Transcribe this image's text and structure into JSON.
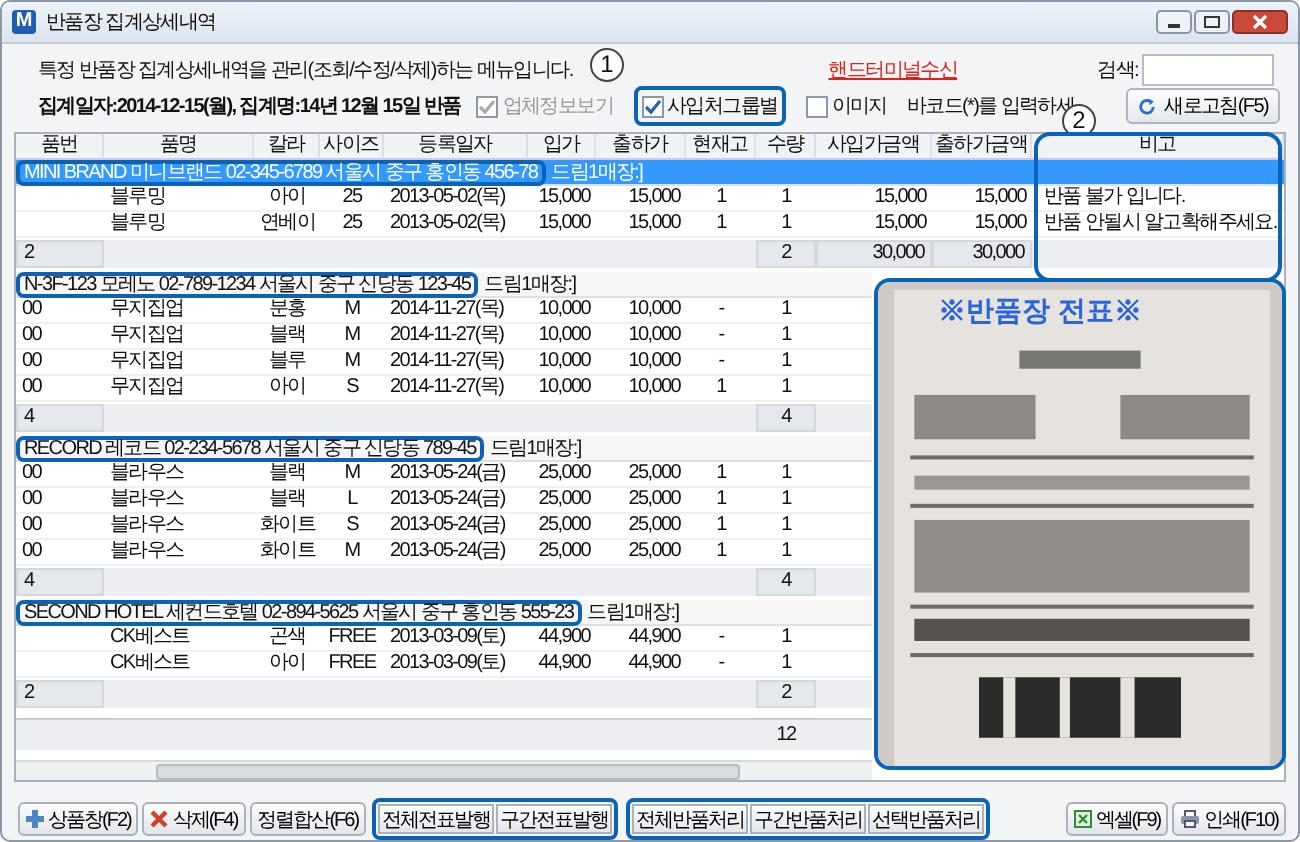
{
  "window": {
    "app_icon": "M",
    "title": "반품장 집계상세내역"
  },
  "header": {
    "description": "특정 반품장 집계상세내역을 관리(조회/수정/삭제)하는 메뉴입니다.",
    "link": "핸드터미널수신",
    "search_label": "검색:",
    "summary": "집계일자:2014-12-15(월), 집계명:14년 12월 15일 반품",
    "options": [
      {
        "label": "업체정보보기",
        "checked": true,
        "disabled": true,
        "highlighted": false
      },
      {
        "label": "사입처그룹별",
        "checked": true,
        "disabled": false,
        "highlighted": true
      },
      {
        "label": "이미지",
        "checked": false,
        "disabled": false,
        "highlighted": false
      }
    ],
    "barcode_hint": "바코드(*)를 입력하세",
    "refresh_button": "새로고침(F5)"
  },
  "markers": [
    "1",
    "2"
  ],
  "table": {
    "columns": [
      "품번",
      "품명",
      "칼라",
      "사이즈",
      "등록일자",
      "입가",
      "출하가",
      "현재고",
      "수량",
      "사입가금액",
      "출하가금액",
      "비고"
    ],
    "groups": [
      {
        "vendor": "MINI BRAND 미니브랜드 02-345-6789  서울시 중구 홍인동 456-78",
        "store": "드림1매장:]",
        "selected": true,
        "highlighted": true,
        "rows": [
          {
            "name": "블루밍",
            "shade": "아이",
            "size": "25",
            "date": "2013-05-02(목)",
            "cost": "15,000",
            "price": "15,000",
            "stock": "1",
            "qty": "1",
            "cost_amount": "15,000",
            "price_amount": "15,000",
            "note": "반품 불가 입니다."
          },
          {
            "name": "블루밍",
            "shade": "연베이",
            "size": "25",
            "date": "2013-05-02(목)",
            "cost": "15,000",
            "price": "15,000",
            "stock": "1",
            "qty": "1",
            "cost_amount": "15,000",
            "price_amount": "15,000",
            "note": "반품 안될시 알고확해주세요."
          }
        ],
        "subtotal": {
          "code": "2",
          "qty": "2",
          "cost_amount": "30,000",
          "price_amount": "30,000"
        }
      },
      {
        "vendor": "N-3F-123 모레노 02-789-1234  서울시 중구 신당동 123-45",
        "store": "드림1매장:]",
        "selected": false,
        "highlighted": true,
        "rows": [
          {
            "code": "00",
            "name": "무지집업",
            "shade": "분홍",
            "size": "M",
            "date": "2014-11-27(목)",
            "cost": "10,000",
            "price": "10,000",
            "stock": "-",
            "qty": "1"
          },
          {
            "code": "00",
            "name": "무지집업",
            "shade": "블랙",
            "size": "M",
            "date": "2014-11-27(목)",
            "cost": "10,000",
            "price": "10,000",
            "stock": "-",
            "qty": "1"
          },
          {
            "code": "00",
            "name": "무지집업",
            "shade": "블루",
            "size": "M",
            "date": "2014-11-27(목)",
            "cost": "10,000",
            "price": "10,000",
            "stock": "-",
            "qty": "1"
          },
          {
            "code": "00",
            "name": "무지집업",
            "shade": "아이",
            "size": "S",
            "date": "2014-11-27(목)",
            "cost": "10,000",
            "price": "10,000",
            "stock": "1",
            "qty": "1"
          }
        ],
        "subtotal": {
          "code": "4",
          "qty": "4"
        }
      },
      {
        "vendor": "RECORD 레코드 02-234-5678  서울시 중구 신당동 789-45",
        "store": "드림1매장:]",
        "selected": false,
        "highlighted": true,
        "rows": [
          {
            "code": "00",
            "name": "블라우스",
            "shade": "블랙",
            "size": "M",
            "date": "2013-05-24(금)",
            "cost": "25,000",
            "price": "25,000",
            "stock": "1",
            "qty": "1"
          },
          {
            "code": "00",
            "name": "블라우스",
            "shade": "블랙",
            "size": "L",
            "date": "2013-05-24(금)",
            "cost": "25,000",
            "price": "25,000",
            "stock": "1",
            "qty": "1"
          },
          {
            "code": "00",
            "name": "블라우스",
            "shade": "화이트",
            "size": "S",
            "date": "2013-05-24(금)",
            "cost": "25,000",
            "price": "25,000",
            "stock": "1",
            "qty": "1"
          },
          {
            "code": "00",
            "name": "블라우스",
            "shade": "화이트",
            "size": "M",
            "date": "2013-05-24(금)",
            "cost": "25,000",
            "price": "25,000",
            "stock": "1",
            "qty": "1"
          }
        ],
        "subtotal": {
          "code": "4",
          "qty": "4"
        }
      },
      {
        "vendor": "SECOND HOTEL 세컨드호텔 02-894-5625  서울시 중구 홍인동 555-23",
        "store": "드림1매장:]",
        "selected": false,
        "highlighted": true,
        "rows": [
          {
            "name": "CK베스트",
            "shade": "곤색",
            "size": "FREE",
            "date": "2013-03-09(토)",
            "cost": "44,900",
            "price": "44,900",
            "stock": "-",
            "qty": "1"
          },
          {
            "name": "CK베스트",
            "shade": "아이",
            "size": "FREE",
            "date": "2013-03-09(토)",
            "cost": "44,900",
            "price": "44,900",
            "stock": "-",
            "qty": "1"
          }
        ],
        "subtotal": {
          "code": "2",
          "qty": "2"
        }
      }
    ],
    "total": {
      "qty": "12"
    }
  },
  "receipt": {
    "caption": "※반품장 전표※",
    "kind": "picture"
  },
  "toolbar": [
    {
      "kind": "add",
      "label": "상품창(F2)"
    },
    {
      "kind": "delete",
      "label": "삭제(F4)"
    },
    {
      "kind": "plain",
      "label": "정렬합산(F6)"
    },
    {
      "kind": "group",
      "highlighted": true,
      "buttons": [
        "전체전표발행",
        "구간전표발행"
      ]
    },
    {
      "kind": "group",
      "highlighted": true,
      "buttons": [
        "전체반품처리",
        "구간반품처리",
        "선택반품처리"
      ]
    },
    {
      "kind": "spacer"
    },
    {
      "kind": "excel",
      "label": "엑셀(F9)"
    },
    {
      "kind": "print",
      "label": "인쇄(F10)"
    }
  ]
}
